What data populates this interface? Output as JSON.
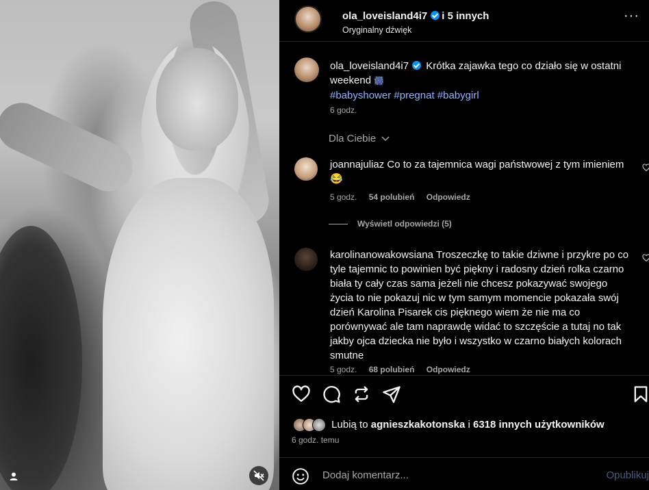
{
  "post": {
    "author": "ola_loveisland4i7",
    "coauthors": "i 5 innych",
    "audio": "Oryginalny dźwięk",
    "caption_user": "ola_loveisland4i7",
    "caption_text": "Krótka zajawka tego co działo się w ostatni weekend",
    "caption_emoji": "🎆",
    "hashtags": "#babyshower #pregnat #babygirl",
    "caption_time": "6 godz."
  },
  "comments_header": {
    "sort_label": "Dla Ciebie"
  },
  "comments": [
    {
      "user": "joannajuliaz",
      "text": "Co to za tajemnica wagi państwowej z tym imieniem😂",
      "time": "5 godz.",
      "likes": "54 polubień",
      "reply": "Odpowiedz",
      "view_replies": "Wyświetl odpowiedzi (5)"
    },
    {
      "user": "karolinanowakowsiana",
      "text": "Troszeczkę to takie dziwne i przykre po co tyle tajemnic to powinien być piękny i radosny dzień rolka czarno biała ty cały czas sama jeżeli nie chcesz pokazywać swojego życia to nie pokazuj nic w tym samym momencie pokazała swój dzień Karolina Pisarek cis pięknego wiem że nie ma co porównywać ale tam naprawdę widać to szczęście a tutaj no tak jakby ojca dziecka nie było i wszystko w czarno białych kolorach smutne",
      "time": "5 godz.",
      "likes": "68 polubień",
      "reply": "Odpowiedz"
    }
  ],
  "likes": {
    "prefix": "Lubią to",
    "user": "agnieszkakotonska",
    "middle": "i",
    "others": "6318 innych użytkowników",
    "time": "6 godz. temu"
  },
  "add_comment": {
    "placeholder": "Dodaj komentarz...",
    "post_label": "Opublikuj"
  },
  "icons": [
    "user-tag-icon",
    "muted-audio-icon",
    "more-options-icon",
    "verified-icon",
    "heart-icon",
    "comment-icon",
    "share-icon",
    "send-icon",
    "save-icon",
    "emoji-icon",
    "chevron-down-icon"
  ]
}
